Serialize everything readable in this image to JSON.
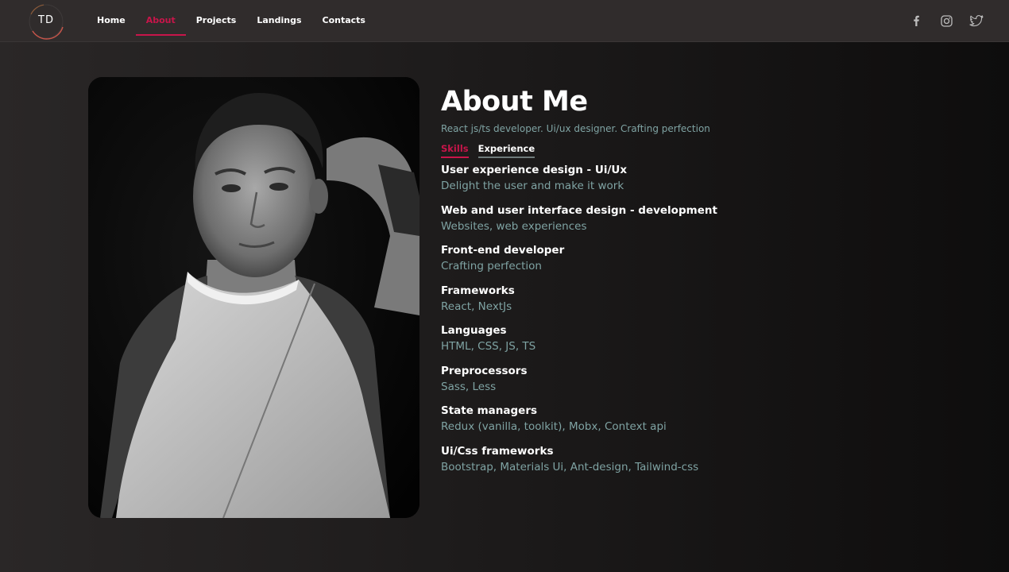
{
  "logo": {
    "text": "TD"
  },
  "nav": {
    "items": [
      {
        "label": "Home",
        "active": false
      },
      {
        "label": "About",
        "active": true
      },
      {
        "label": "Projects",
        "active": false
      },
      {
        "label": "Landings",
        "active": false
      },
      {
        "label": "Contacts",
        "active": false
      }
    ]
  },
  "social": [
    "facebook-icon",
    "instagram-icon",
    "twitter-icon"
  ],
  "about": {
    "title": "About Me",
    "subtitle": "React js/ts developer. Ui/ux designer. Crafting perfection",
    "tabs": [
      {
        "label": "Skills",
        "active": true
      },
      {
        "label": "Experience",
        "active": false
      }
    ],
    "skills": [
      {
        "title": "User experience design - Ui/Ux",
        "desc": "Delight the user and make it work"
      },
      {
        "title": "Web and user interface design - development",
        "desc": "Websites, web experiences"
      },
      {
        "title": "Front-end developer",
        "desc": "Crafting perfection"
      },
      {
        "title": "Frameworks",
        "desc": "React, NextJs"
      },
      {
        "title": "Languages",
        "desc": "HTML, CSS, JS, TS"
      },
      {
        "title": "Preprocessors",
        "desc": "Sass, Less"
      },
      {
        "title": "State managers",
        "desc": "Redux (vanilla, toolkit), Mobx, Context api"
      },
      {
        "title": "Ui/Css frameworks",
        "desc": "Bootstrap, Materials Ui, Ant-design, Tailwind-css"
      }
    ]
  },
  "colors": {
    "accent": "#c8154a",
    "muted_text": "#7fa3a3",
    "nav_bg": "#302c2c"
  }
}
